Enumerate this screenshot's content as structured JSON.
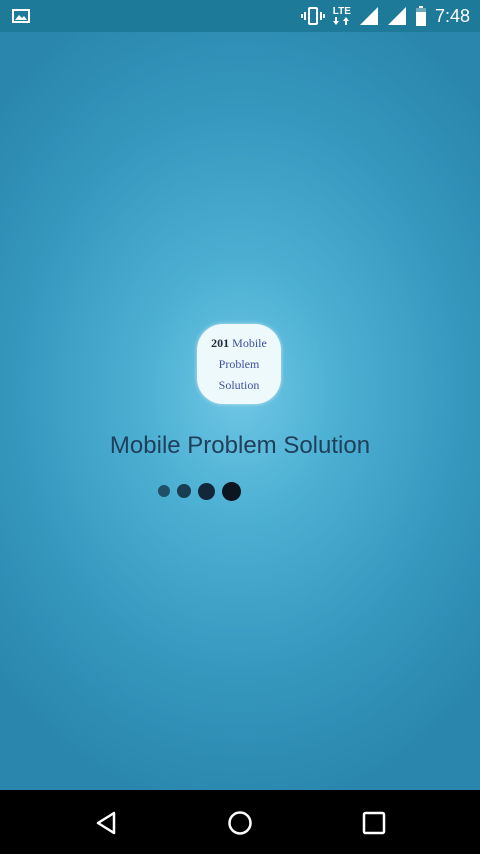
{
  "status_bar": {
    "time": "7:48",
    "network_label": "LTE",
    "icons": [
      "image-notification-icon",
      "vibrate-icon",
      "lte-icon",
      "signal-icon",
      "signal-icon-2",
      "battery-icon"
    ]
  },
  "app": {
    "logo": {
      "number": "201",
      "line1_word": "Mobile",
      "line2": "Problem",
      "line3": "Solution"
    },
    "title": "Mobile Problem Solution",
    "loading_indicator_dots": 4
  },
  "nav_bar": {
    "buttons": [
      "back-icon",
      "home-icon",
      "recents-icon"
    ]
  },
  "colors": {
    "background_center": "#6fc6e4",
    "background_edge": "#2a86ad",
    "status_bar": "#1d7a99",
    "title_text": "#1f3f5a",
    "nav_bar": "#000000"
  }
}
